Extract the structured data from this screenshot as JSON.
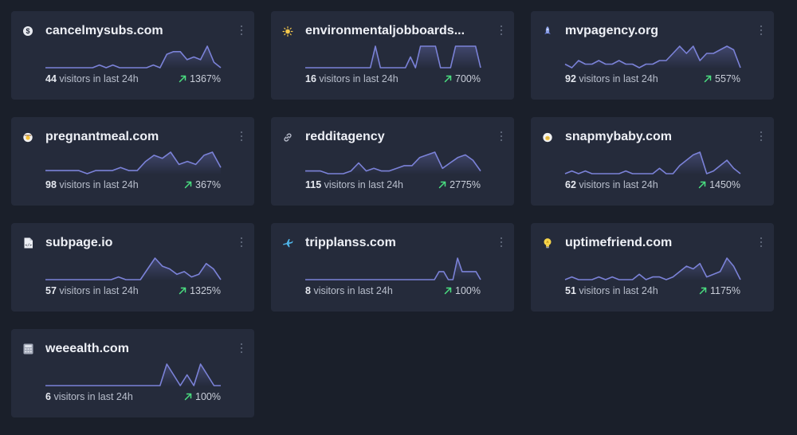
{
  "colors": {
    "background": "#1a1f2a",
    "card": "#252b3b",
    "sparkline": "#7b82d8",
    "trend_up": "#4ade80"
  },
  "visitors_suffix": "visitors in last 24h",
  "cards": [
    {
      "name": "cancelmysubs.com",
      "icon": "dollar-coin-icon",
      "visitors": "44",
      "growth": "1367%",
      "trend": [
        0,
        0,
        0,
        0,
        0,
        0,
        0,
        0,
        1,
        0,
        1,
        0,
        0,
        0,
        0,
        0,
        1,
        0,
        5,
        6,
        6,
        3,
        4,
        3,
        8,
        2,
        0
      ]
    },
    {
      "name": "environmentaljobboards...",
      "icon": "sun-icon",
      "visitors": "16",
      "growth": "700%",
      "trend": [
        0,
        0,
        0,
        0,
        0,
        0,
        0,
        0,
        0,
        0,
        0,
        0,
        0,
        0,
        8,
        0,
        0,
        0,
        0,
        0,
        0,
        4,
        0,
        8,
        8,
        8,
        8,
        0,
        0,
        0,
        8,
        8,
        8,
        8,
        8,
        0
      ]
    },
    {
      "name": "mvpagency.org",
      "icon": "rocket-icon",
      "visitors": "92",
      "growth": "557%",
      "trend": [
        1,
        0,
        2,
        1,
        1,
        2,
        1,
        1,
        2,
        1,
        1,
        0,
        1,
        1,
        2,
        2,
        4,
        6,
        4,
        6,
        2,
        4,
        4,
        5,
        6,
        5,
        0
      ]
    },
    {
      "name": "pregnantmeal.com",
      "icon": "meal-emoji-icon",
      "visitors": "98",
      "growth": "367%",
      "trend": [
        1,
        1,
        1,
        1,
        1,
        0,
        1,
        1,
        1,
        2,
        1,
        1,
        4,
        6,
        5,
        7,
        3,
        4,
        3,
        6,
        7,
        2
      ]
    },
    {
      "name": "redditagency",
      "icon": "link-icon",
      "visitors": "115",
      "growth": "2775%",
      "trend": [
        1,
        1,
        1,
        0,
        0,
        0,
        1,
        4,
        1,
        2,
        1,
        1,
        2,
        3,
        3,
        6,
        7,
        8,
        2,
        4,
        6,
        7,
        5,
        1
      ]
    },
    {
      "name": "snapmybaby.com",
      "icon": "baby-emoji-icon",
      "visitors": "62",
      "growth": "1450%",
      "trend": [
        0,
        1,
        0,
        1,
        0,
        0,
        0,
        0,
        0,
        1,
        0,
        0,
        0,
        0,
        2,
        0,
        0,
        3,
        5,
        7,
        8,
        0,
        1,
        3,
        5,
        2,
        0
      ]
    },
    {
      "name": "subpage.io",
      "icon": "document-icon",
      "visitors": "57",
      "growth": "1325%",
      "trend": [
        0,
        0,
        0,
        0,
        0,
        0,
        0,
        0,
        0,
        0,
        1,
        0,
        0,
        0,
        4,
        8,
        5,
        4,
        2,
        3,
        1,
        2,
        6,
        4,
        0
      ]
    },
    {
      "name": "tripplanss.com",
      "icon": "airplane-icon",
      "visitors": "8",
      "growth": "100%",
      "trend": [
        0,
        0,
        0,
        0,
        0,
        0,
        0,
        0,
        0,
        0,
        0,
        0,
        0,
        0,
        0,
        0,
        0,
        0,
        0,
        0,
        0,
        0,
        0,
        0,
        0,
        0,
        0,
        0,
        0,
        3,
        3,
        0,
        0,
        8,
        3,
        3,
        3,
        3,
        0
      ]
    },
    {
      "name": "uptimefriend.com",
      "icon": "lightbulb-icon",
      "visitors": "51",
      "growth": "1175%",
      "trend": [
        0,
        1,
        0,
        0,
        0,
        1,
        0,
        1,
        0,
        0,
        0,
        2,
        0,
        1,
        1,
        0,
        1,
        3,
        5,
        4,
        6,
        1,
        2,
        3,
        8,
        5,
        0
      ]
    },
    {
      "name": "weeealth.com",
      "icon": "calculator-icon",
      "visitors": "6",
      "growth": "100%",
      "trend": [
        0,
        0,
        0,
        0,
        0,
        0,
        0,
        0,
        0,
        0,
        0,
        0,
        0,
        0,
        0,
        0,
        0,
        0,
        8,
        4,
        0,
        4,
        0,
        8,
        4,
        0,
        0
      ]
    }
  ]
}
